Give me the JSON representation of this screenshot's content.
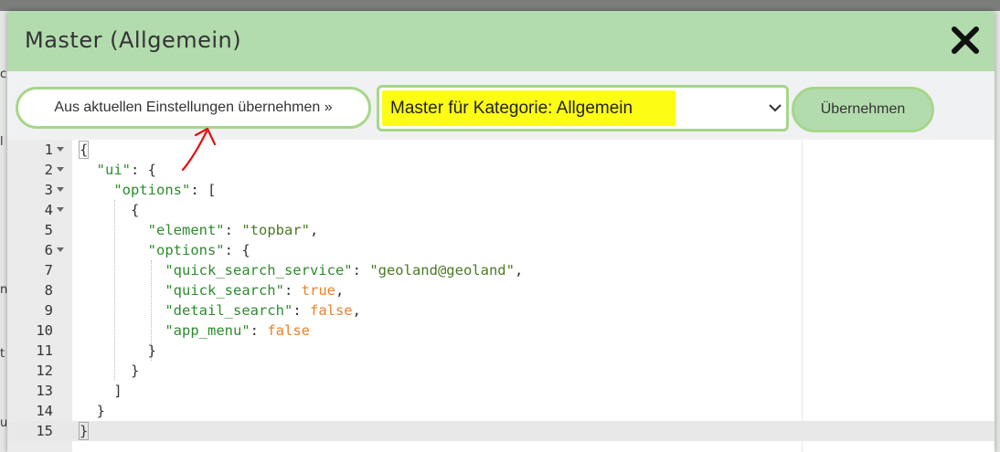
{
  "dialog": {
    "title": "Master (Allgemein)",
    "close_icon": "close-icon"
  },
  "toolbar": {
    "apply_settings_label": "Aus aktuellen Einstellungen übernehmen »",
    "master_select_value": "Master für Kategorie: Allgemein",
    "submit_label": "Übernehmen"
  },
  "colors": {
    "header_bg": "#b3dcae",
    "button_border": "#a6d68a",
    "highlight": "#fcfc14",
    "annotation": "#e01010"
  },
  "background_fragments": [
    "c",
    "l",
    "n",
    "t",
    "u"
  ],
  "editor": {
    "active_line": 15,
    "lines": [
      {
        "n": "1",
        "fold": true,
        "parts": [
          [
            "p",
            "{"
          ]
        ]
      },
      {
        "n": "2",
        "fold": true,
        "parts": [
          [
            "p",
            "  "
          ],
          [
            "k",
            "\"ui\""
          ],
          [
            "p",
            ": {"
          ]
        ]
      },
      {
        "n": "3",
        "fold": true,
        "parts": [
          [
            "p",
            "    "
          ],
          [
            "k",
            "\"options\""
          ],
          [
            "p",
            ": ["
          ]
        ]
      },
      {
        "n": "4",
        "fold": true,
        "parts": [
          [
            "p",
            "      {"
          ]
        ]
      },
      {
        "n": "5",
        "fold": false,
        "parts": [
          [
            "p",
            "        "
          ],
          [
            "k",
            "\"element\""
          ],
          [
            "p",
            ": "
          ],
          [
            "s",
            "\"topbar\""
          ],
          [
            "p",
            ","
          ]
        ]
      },
      {
        "n": "6",
        "fold": true,
        "parts": [
          [
            "p",
            "        "
          ],
          [
            "k",
            "\"options\""
          ],
          [
            "p",
            ": {"
          ]
        ]
      },
      {
        "n": "7",
        "fold": false,
        "parts": [
          [
            "p",
            "          "
          ],
          [
            "k",
            "\"quick_search_service\""
          ],
          [
            "p",
            ": "
          ],
          [
            "s",
            "\"geoland@geoland\""
          ],
          [
            "p",
            ","
          ]
        ]
      },
      {
        "n": "8",
        "fold": false,
        "parts": [
          [
            "p",
            "          "
          ],
          [
            "k",
            "\"quick_search\""
          ],
          [
            "p",
            ": "
          ],
          [
            "kw",
            "true"
          ],
          [
            "p",
            ","
          ]
        ]
      },
      {
        "n": "9",
        "fold": false,
        "parts": [
          [
            "p",
            "          "
          ],
          [
            "k",
            "\"detail_search\""
          ],
          [
            "p",
            ": "
          ],
          [
            "kw",
            "false"
          ],
          [
            "p",
            ","
          ]
        ]
      },
      {
        "n": "10",
        "fold": false,
        "parts": [
          [
            "p",
            "          "
          ],
          [
            "k",
            "\"app_menu\""
          ],
          [
            "p",
            ": "
          ],
          [
            "kw",
            "false"
          ]
        ]
      },
      {
        "n": "11",
        "fold": false,
        "parts": [
          [
            "p",
            "        }"
          ]
        ]
      },
      {
        "n": "12",
        "fold": false,
        "parts": [
          [
            "p",
            "      }"
          ]
        ]
      },
      {
        "n": "13",
        "fold": false,
        "parts": [
          [
            "p",
            "    ]"
          ]
        ]
      },
      {
        "n": "14",
        "fold": false,
        "parts": [
          [
            "p",
            "  }"
          ]
        ]
      },
      {
        "n": "15",
        "fold": false,
        "parts": [
          [
            "p",
            "}"
          ]
        ]
      }
    ]
  }
}
